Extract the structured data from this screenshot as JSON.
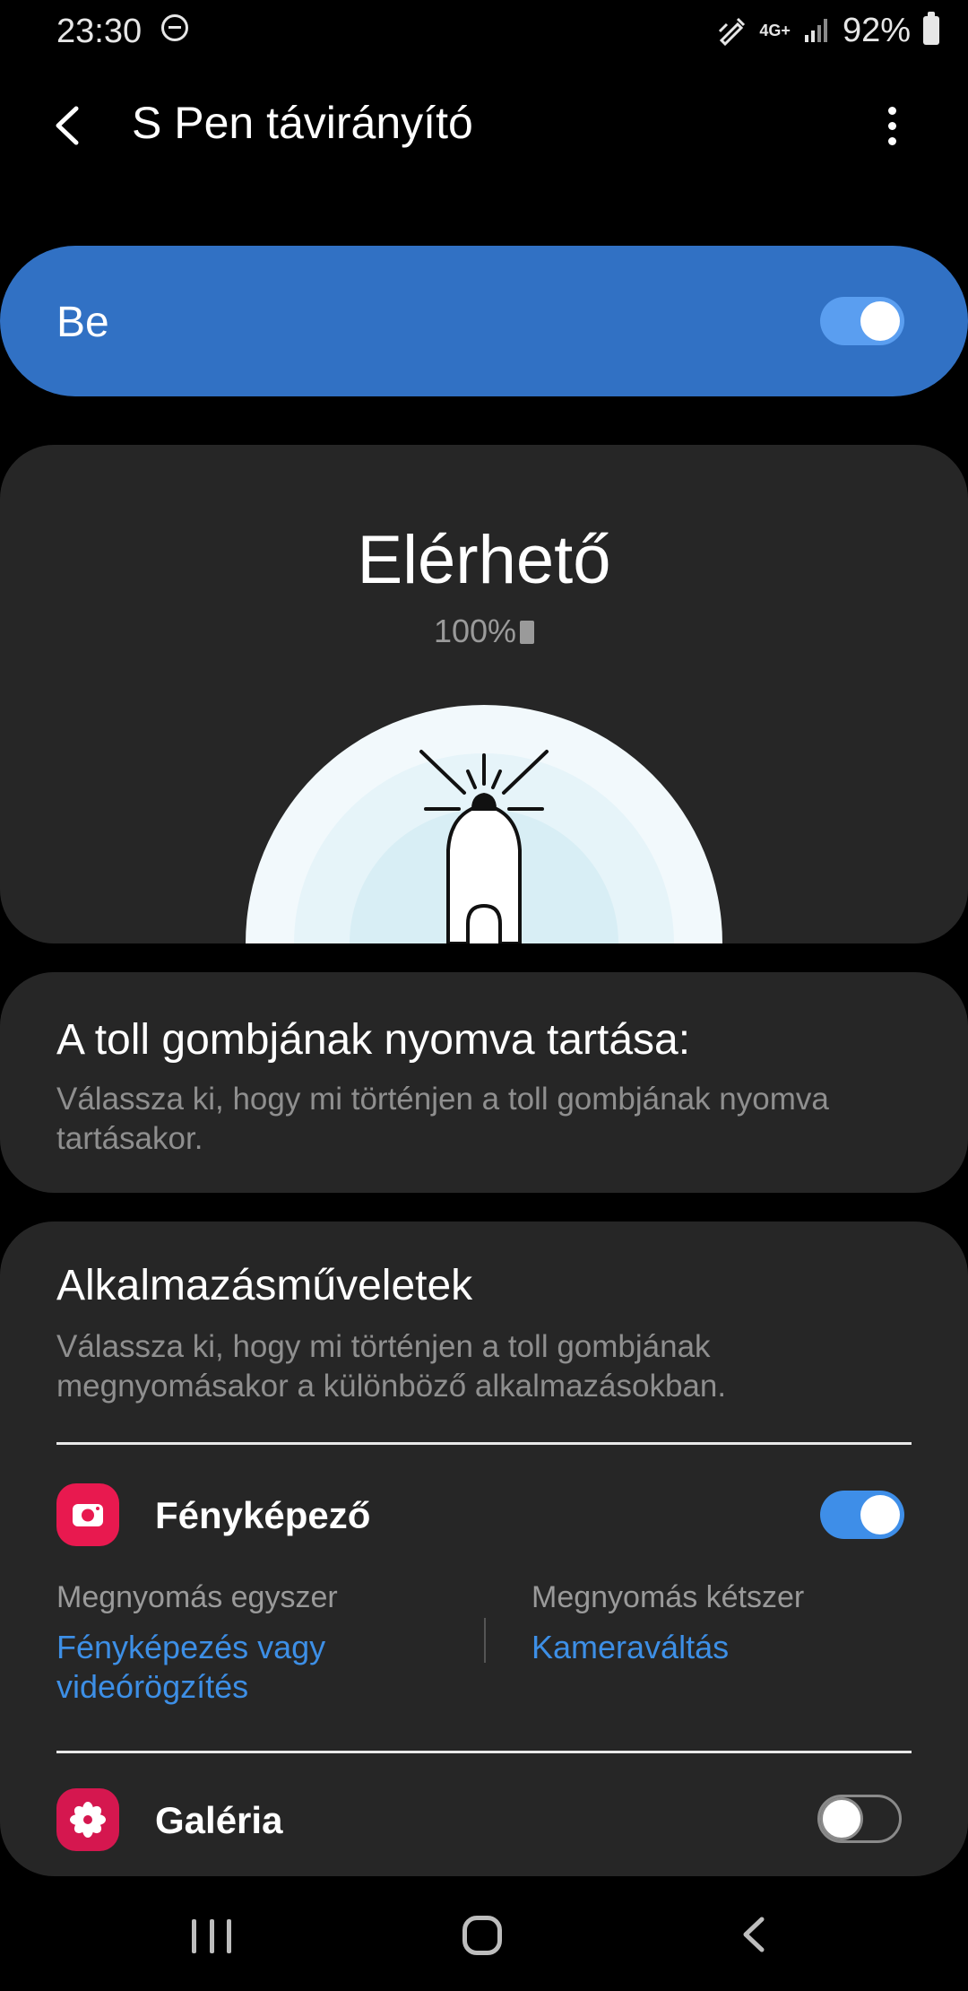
{
  "status_bar": {
    "time": "23:30",
    "battery": "92%",
    "network": "4G+"
  },
  "header": {
    "title": "S Pen távirányító"
  },
  "master_switch": {
    "label": "Be",
    "state": "on"
  },
  "status_card": {
    "status": "Elérhető",
    "battery": "100%"
  },
  "hold_section": {
    "title": "A toll gombjának nyomva tartása:",
    "description": "Válassza ki, hogy mi történjen a toll gombjának nyomva tartásakor."
  },
  "app_actions": {
    "title": "Alkalmazásműveletek",
    "description": "Válassza ki, hogy mi történjen a toll gombjának megnyomásakor a különböző alkalmazásokban.",
    "apps": [
      {
        "name": "Fényképező",
        "enabled": true,
        "icon": "camera-icon",
        "single_press_label": "Megnyomás egyszer",
        "single_press_value": "Fényképezés vagy videórögzítés",
        "double_press_label": "Megnyomás kétszer",
        "double_press_value": "Kameraváltás"
      },
      {
        "name": "Galéria",
        "enabled": false,
        "icon": "gallery-flower-icon"
      }
    ]
  },
  "colors": {
    "accent": "#3171c4",
    "link": "#3d8fe6",
    "card": "#262626",
    "camera_icon": "#e8194f",
    "gallery_icon": "#d5174f"
  }
}
